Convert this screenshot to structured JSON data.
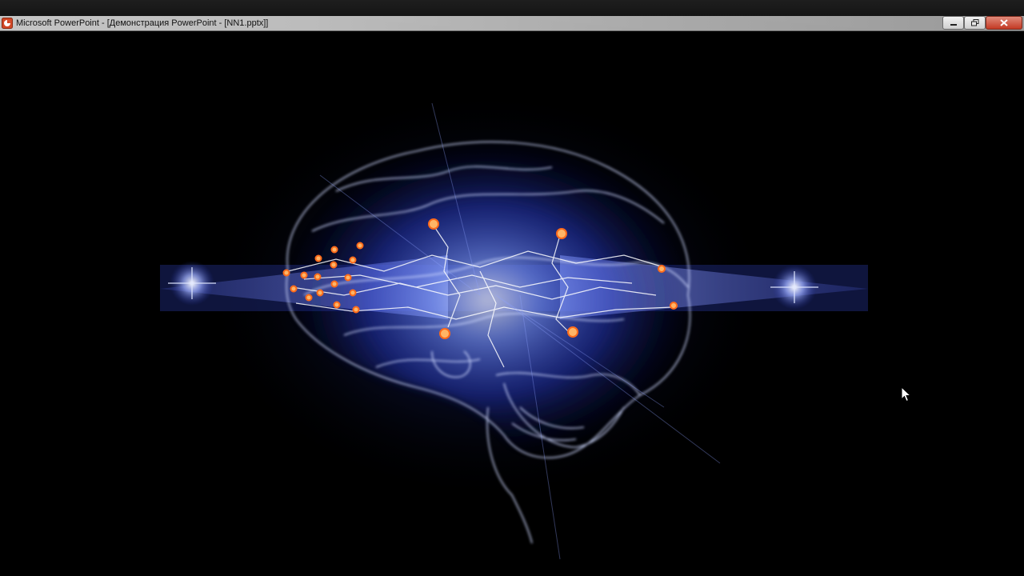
{
  "window": {
    "title": "Microsoft PowerPoint - [Демонстрация PowerPoint - [NN1.pptx]]",
    "app_icon": "powerpoint-icon",
    "controls": [
      "minimize-icon",
      "restore-icon",
      "close-icon"
    ]
  },
  "slide": {
    "image": "glowing-brain-illustration",
    "colors": {
      "background": "#000000",
      "glow": "#3a5cff",
      "nodes": "#ff8a2a"
    }
  },
  "cursor": "arrow-cursor-icon"
}
